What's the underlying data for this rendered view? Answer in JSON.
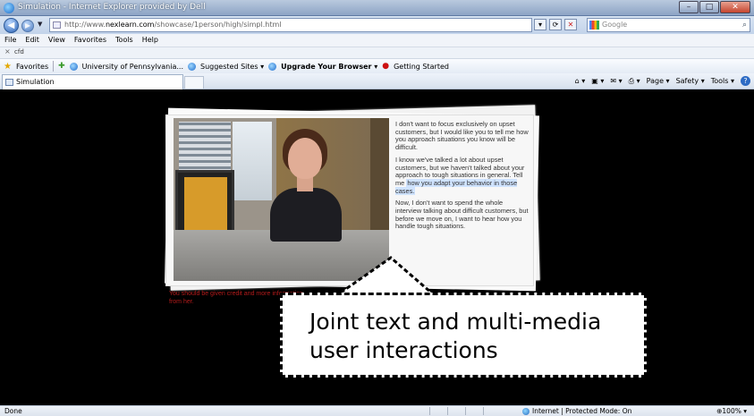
{
  "window": {
    "title": "Simulation - Internet Explorer provided by Dell"
  },
  "address": {
    "url_prefix": "http://www.",
    "url_domain": "nexlearn.com",
    "url_path": "/showcase/1person/high/simpl.html"
  },
  "search": {
    "placeholder": "Google"
  },
  "menu": [
    "File",
    "Edit",
    "View",
    "Favorites",
    "Tools",
    "Help"
  ],
  "findbar": {
    "text": "cfd"
  },
  "favorites": {
    "label": "Favorites",
    "items": [
      "University of Pennsylvania...",
      "Suggested Sites ▾",
      "Upgrade Your Browser ▾",
      "Getting Started"
    ]
  },
  "tab": {
    "label": "Simulation"
  },
  "command_bar": {
    "page": "Page ▾",
    "safety": "Safety ▾",
    "tools": "Tools ▾"
  },
  "dialogue": {
    "p1": "I don't want to focus exclusively on upset customers, but I would like you to tell me how you approach situations you know will be difficult.",
    "p2_before": "I know we've talked a lot about upset customers, but we haven't talked about your approach to tough situations in general. Tell me ",
    "p2_highlight": "how you adapt your behavior in those cases.",
    "p3": "Now, I don't want to spend the whole interview talking about difficult customers, but before we move on, I want to hear how you handle tough situations."
  },
  "red_caption": "You should be given credit and more information from her.",
  "callout": {
    "text": "Joint text and multi-media user interactions"
  },
  "status": {
    "left": "Done",
    "zone": "Internet | Protected Mode: On",
    "zoom": "⊕100% ▾"
  }
}
